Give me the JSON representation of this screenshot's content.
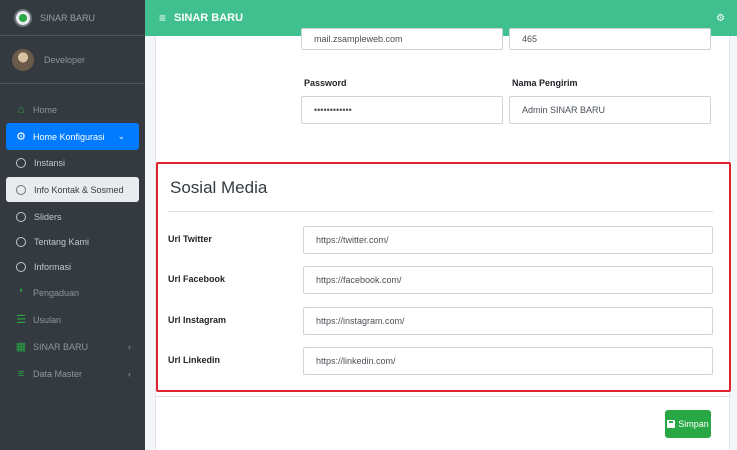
{
  "sidebar": {
    "brand": "SINAR BARU",
    "user": "Developer",
    "items": [
      {
        "label": "Home",
        "icon": "home-icon"
      },
      {
        "label": "Home Konfigurasi",
        "icon": "cogs-icon"
      },
      {
        "label": "Instansi"
      },
      {
        "label": "Info Kontak & Sosmed"
      },
      {
        "label": "Sliders"
      },
      {
        "label": "Tentang Kami"
      },
      {
        "label": "Informasi"
      },
      {
        "label": "Pengaduan",
        "icon": "chat-icon"
      },
      {
        "label": "Usulan",
        "icon": "list-icon"
      },
      {
        "label": "SINAR BARU",
        "icon": "building-icon"
      },
      {
        "label": "Data Master",
        "icon": "database-icon"
      }
    ]
  },
  "topbar": {
    "title": "SINAR BARU",
    "menu_icon": "hamburger-icon",
    "settings_icon": "gear-icon"
  },
  "form": {
    "email_value": "mail.zsampleweb.com",
    "port_value": "465",
    "password_label": "Password",
    "password_value": "••••••••••••",
    "sender_label": "Nama Pengirim",
    "sender_value": "Admin SINAR BARU",
    "social_title": "Sosial Media",
    "twitter_label": "Url Twitter",
    "twitter_value": "https://twitter.com/",
    "facebook_label": "Url Facebook",
    "facebook_value": "https://facebook.com/",
    "instagram_label": "Url Instagram",
    "instagram_value": "https://instagram.com/",
    "linkedin_label": "Url Linkedin",
    "linkedin_value": "https://linkedin.com/",
    "save_label": "Simpan"
  },
  "colors": {
    "topbar": "#3fc08e",
    "sidebar": "#343a40",
    "active": "#007bff",
    "highlight": "#e0242e",
    "save": "#28a745"
  }
}
